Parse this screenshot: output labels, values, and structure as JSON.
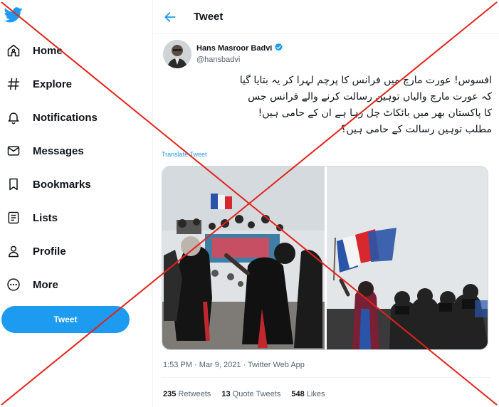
{
  "sidebar": {
    "logo_icon": "twitter-bird-icon",
    "items": [
      {
        "label": "Home",
        "icon": "home-icon"
      },
      {
        "label": "Explore",
        "icon": "hashtag-icon"
      },
      {
        "label": "Notifications",
        "icon": "bell-icon"
      },
      {
        "label": "Messages",
        "icon": "envelope-icon"
      },
      {
        "label": "Bookmarks",
        "icon": "bookmark-icon"
      },
      {
        "label": "Lists",
        "icon": "list-icon"
      },
      {
        "label": "Profile",
        "icon": "person-icon"
      },
      {
        "label": "More",
        "icon": "more-circle-icon"
      }
    ],
    "tweet_button": "Tweet"
  },
  "header": {
    "title": "Tweet",
    "back_icon": "back-arrow-icon"
  },
  "tweet": {
    "author_name": "Hans Masroor Badvi",
    "author_handle": "@hansbadvi",
    "verified": true,
    "text_lines": [
      "افسوس! عورت مارچ میں فرانس کا پرچم لہرا کر یہ بتایا گیا",
      "کہ عورت مارچ والیاں توہین رسالت کرنے والے فرانس جس",
      "کا پاکستان بھر میں بائکاٹ چل رہا ہے ان کے حامی ہیں!",
      "مطلب توہین رسالت کے حامی ہیں؟"
    ],
    "translate": "Translate Tweet",
    "meta": "1:53 PM · Mar 9, 2021 · Twitter Web App",
    "retweets_count": "235",
    "retweets_label": "Retweets",
    "quotes_count": "13",
    "quotes_label": "Quote Tweets",
    "likes_count": "548",
    "likes_label": "Likes"
  },
  "colors": {
    "accent": "#1d9bf0",
    "text": "#0f1419",
    "muted": "#536471",
    "cross": "#e2231a"
  }
}
